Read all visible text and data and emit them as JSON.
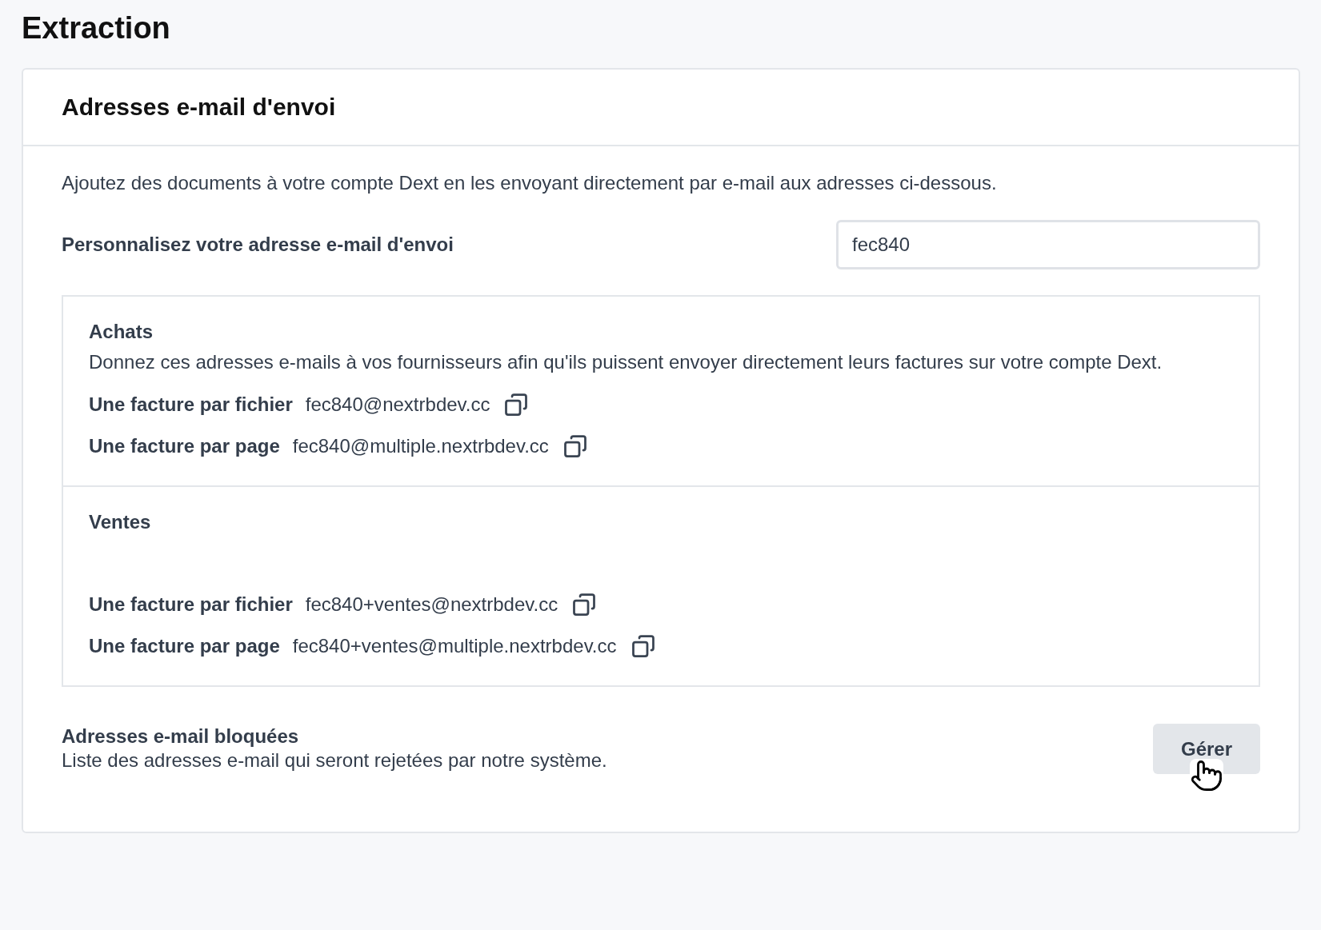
{
  "page_title": "Extraction",
  "card": {
    "title": "Adresses e-mail d'envoi",
    "intro": "Ajoutez des documents à votre compte Dext en les envoyant directement par e-mail aux adresses ci-dessous.",
    "custom_field": {
      "label": "Personnalisez votre adresse e-mail d'envoi",
      "value": "fec840"
    },
    "sections": [
      {
        "title": "Achats",
        "description": "Donnez ces adresses e-mails à vos fournisseurs afin qu'ils puissent envoyer directement leurs factures sur votre compte Dext.",
        "addresses": [
          {
            "label": "Une facture par fichier",
            "email": "fec840@nextrbdev.cc"
          },
          {
            "label": "Une facture par page",
            "email": "fec840@multiple.nextrbdev.cc"
          }
        ]
      },
      {
        "title": "Ventes",
        "addresses": [
          {
            "label": "Une facture par fichier",
            "email": "fec840+ventes@nextrbdev.cc"
          },
          {
            "label": "Une facture par page",
            "email": "fec840+ventes@multiple.nextrbdev.cc"
          }
        ]
      }
    ],
    "blocked": {
      "title": "Adresses e-mail bloquées",
      "description": "Liste des adresses e-mail qui seront rejetées par notre système.",
      "button": "Gérer"
    }
  }
}
